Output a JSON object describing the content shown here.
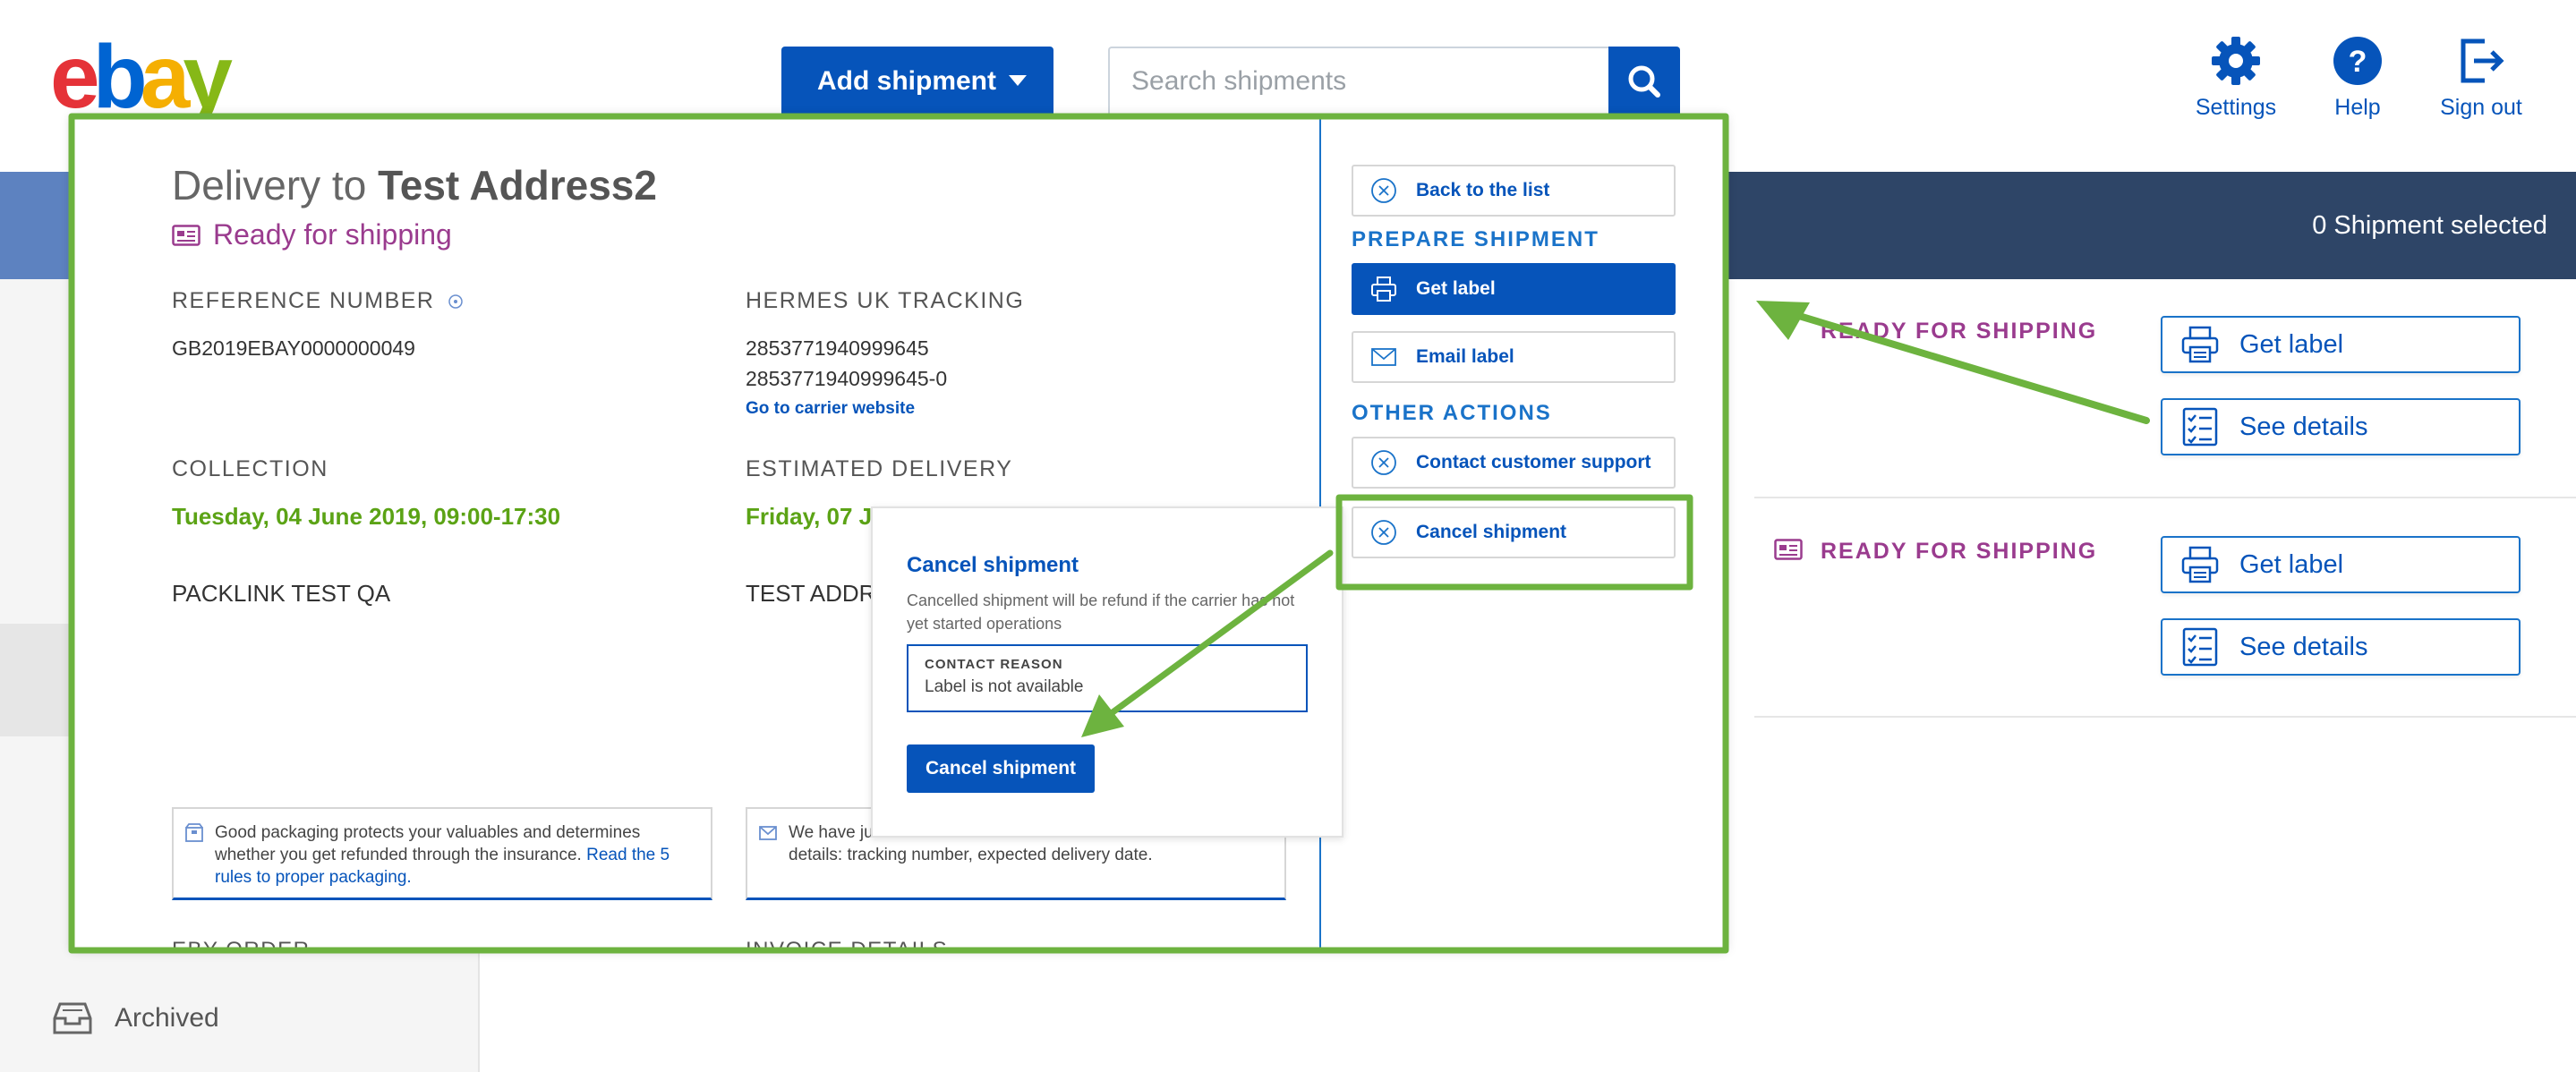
{
  "header": {
    "logo_text": "ebay",
    "add_shipment_label": "Add shipment",
    "search_placeholder": "Search shipments",
    "settings_label": "Settings",
    "help_label": "Help",
    "signout_label": "Sign out"
  },
  "sidebar": {
    "archived_label": "Archived"
  },
  "list": {
    "selected_count_text": "0 Shipment selected",
    "rows": [
      {
        "status": "READY FOR SHIPPING",
        "get_label": "Get label",
        "see_details": "See details"
      },
      {
        "status": "READY FOR SHIPPING",
        "get_label": "Get label",
        "see_details": "See details"
      }
    ]
  },
  "detail": {
    "title_prefix": "Delivery to",
    "title_name": "Test Address2",
    "status": "Ready for shipping",
    "reference_label": "REFERENCE NUMBER",
    "reference_value": "GB2019EBAY0000000049",
    "tracking_label": "HERMES UK TRACKING",
    "tracking_1": "2853771940999645",
    "tracking_2": "2853771940999645-0",
    "carrier_link": "Go to carrier website",
    "collection_label": "COLLECTION",
    "collection_value": "Tuesday, 04 June 2019, 09:00-17:30",
    "estimated_label": "ESTIMATED DELIVERY",
    "estimated_value": "Friday, 07 J",
    "sender_name": "PACKLINK TEST QA",
    "recipient_name": "TEST ADDR",
    "packaging_text": "Good packaging protects your valuables and determines whether you get refunded through the insurance.",
    "packaging_link": "Read the 5 rules to proper packaging.",
    "email_text_1": "We have ju",
    "email_text_2": "details: tracking number, expected delivery date.",
    "ebay_order_label": "EBY ORDER",
    "invoice_label": "INVOICE DETAILS"
  },
  "actions": {
    "back_label": "Back to the list",
    "prepare_heading": "PREPARE SHIPMENT",
    "get_label": "Get label",
    "email_label": "Email label",
    "other_heading": "OTHER ACTIONS",
    "contact_label": "Contact customer support",
    "cancel_label": "Cancel shipment"
  },
  "cancel_popover": {
    "title": "Cancel shipment",
    "description": "Cancelled shipment will be refund if the carrier has not yet started operations",
    "reason_label": "CONTACT REASON",
    "reason_value": "Label is not available",
    "button_label": "Cancel shipment"
  },
  "colors": {
    "brand_blue": "#0654ba",
    "status_purple": "#9a3b8e",
    "green_date": "#5ba315",
    "annotation_green": "#6db33f",
    "top_bar": "#2e4567"
  }
}
